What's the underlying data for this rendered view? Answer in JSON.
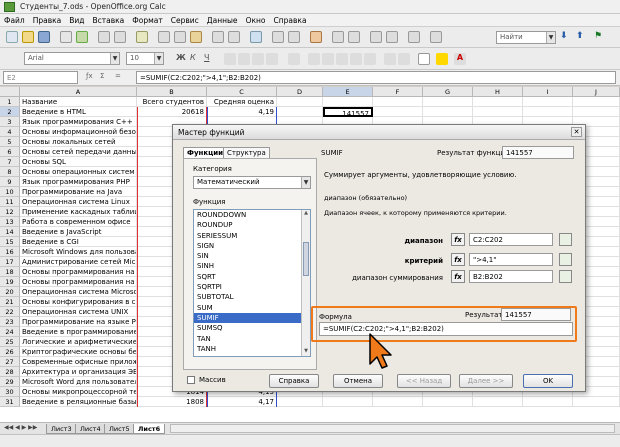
{
  "window": {
    "title": "Студенты_7.ods - OpenOffice.org Calc"
  },
  "menu": [
    "Файл",
    "Правка",
    "Вид",
    "Вставка",
    "Формат",
    "Сервис",
    "Данные",
    "Окно",
    "Справка"
  ],
  "toolbar": {
    "font": "Arial",
    "size": "10",
    "search_placeholder": "Найти"
  },
  "formula_bar": {
    "cell": "E2",
    "formula": "=SUMIF(C2:C202;\">4,1\";B2:B202)"
  },
  "columns": [
    "A",
    "B",
    "C",
    "D",
    "E",
    "F",
    "G",
    "H",
    "I",
    "J"
  ],
  "rows": [
    {
      "n": "1",
      "a": "Название",
      "b": "Всего студентов",
      "c": "Средняя оценка"
    },
    {
      "n": "2",
      "a": "Введение в HTML",
      "b": "20618",
      "c": "4,19",
      "e": "141557"
    },
    {
      "n": "3",
      "a": "Язык программирования C++"
    },
    {
      "n": "4",
      "a": "Основы информационной безоп"
    },
    {
      "n": "5",
      "a": "Основы локальных сетей"
    },
    {
      "n": "6",
      "a": "Основы сетей передачи данны"
    },
    {
      "n": "7",
      "a": "Основы SQL"
    },
    {
      "n": "8",
      "a": "Основы операционных систем"
    },
    {
      "n": "9",
      "a": "Язык программирования PHP"
    },
    {
      "n": "10",
      "a": "Программирование на Java"
    },
    {
      "n": "11",
      "a": "Операционная система Linux"
    },
    {
      "n": "12",
      "a": "Применение каскадных таблиц"
    },
    {
      "n": "13",
      "a": "Работа в современном офисе"
    },
    {
      "n": "14",
      "a": "Введение в JavaScript"
    },
    {
      "n": "15",
      "a": "Введение в CGI"
    },
    {
      "n": "16",
      "a": "Microsoft Windows для пользова"
    },
    {
      "n": "17",
      "a": "Администрирование сетей Micro"
    },
    {
      "n": "18",
      "a": "Основы программирования на C"
    },
    {
      "n": "19",
      "a": "Основы программирования на я"
    },
    {
      "n": "20",
      "a": "Операционная система Microso"
    },
    {
      "n": "21",
      "a": "Основы конфигурирования в си"
    },
    {
      "n": "22",
      "a": "Операционная система UNIX"
    },
    {
      "n": "23",
      "a": "Программирование на языке Р"
    },
    {
      "n": "24",
      "a": "Введение в программирование"
    },
    {
      "n": "25",
      "a": "Логические и арифметические о"
    },
    {
      "n": "26",
      "a": "Криптографические основы без"
    },
    {
      "n": "27",
      "a": "Современные офисные прилож"
    },
    {
      "n": "28",
      "a": "Архитектура и организация ЭВМ"
    },
    {
      "n": "29",
      "a": "Microsoft Word для пользовател"
    },
    {
      "n": "30",
      "a": "Основы микропроцессорной тех",
      "b": "1814",
      "c": "4,15"
    },
    {
      "n": "31",
      "a": "Введение в реляционные базы",
      "b": "1808",
      "c": "4,17"
    }
  ],
  "sheet_tabs": [
    "Лист3",
    "Лист4",
    "Лист5",
    "Лист6"
  ],
  "dialog": {
    "title": "Мастер функций",
    "tabs": [
      "Функции",
      "Структура"
    ],
    "category_label": "Категория",
    "category_value": "Математический",
    "function_label": "Функция",
    "functions": [
      "ROUNDDOWN",
      "ROUNDUP",
      "SERIESSUM",
      "SIGN",
      "SIN",
      "SINH",
      "SQRT",
      "SQRTPI",
      "SUBTOTAL",
      "SUM",
      "SUMIF",
      "SUMSQ",
      "TAN",
      "TANH",
      "TRUNC"
    ],
    "selected_function": "SUMIF",
    "fn_name": "SUMIF",
    "fn_result_label": "Результат функции",
    "fn_result": "141557",
    "description": "Суммирует аргументы, удовлетворяющие условию.",
    "arg_title": "диапазон (обязательно)",
    "arg_desc": "Диапазон ячеек, к которому применяются критерии.",
    "args": [
      {
        "label": "диапазон",
        "value": "C2:C202"
      },
      {
        "label": "критерий",
        "value": "\">4,1\""
      },
      {
        "label": "диапазон суммирования",
        "value": "B2:B202"
      }
    ],
    "formula_label": "Формула",
    "result_label": "Результат",
    "result_value": "141557",
    "formula_value": "=SUMIF(C2:C202;\">4,1\";B2:B202)",
    "array_label": "Массив",
    "buttons": {
      "help": "Справка",
      "cancel": "Отмена",
      "back": "<< Назад",
      "next": "Далее >>",
      "ok": "OK"
    }
  }
}
